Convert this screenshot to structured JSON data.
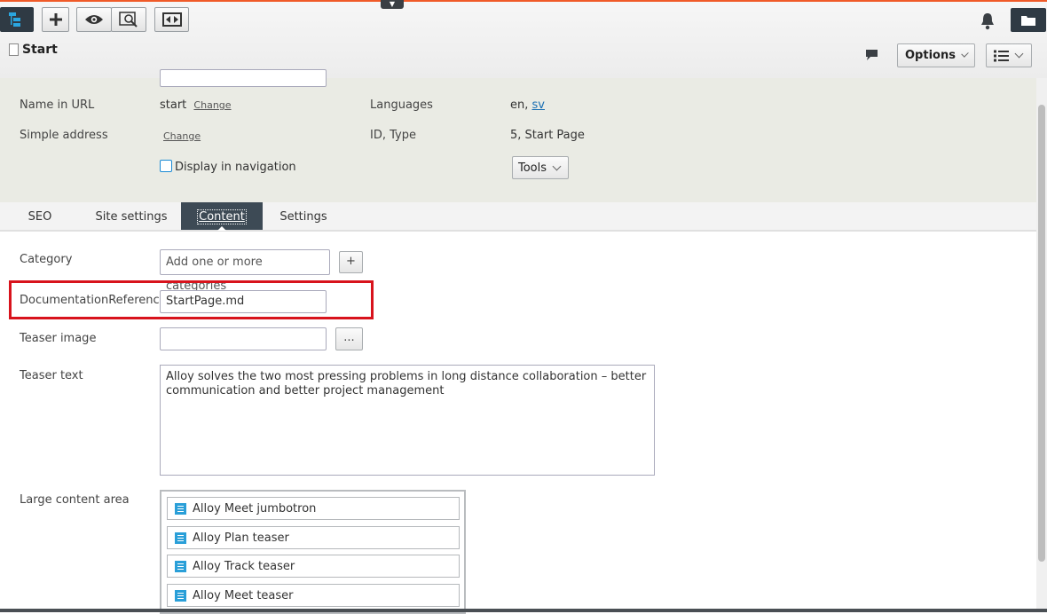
{
  "header": {
    "page_title": "Start",
    "options_label": "Options"
  },
  "props": {
    "name_url_label": "Name in URL",
    "name_url_value": "start",
    "change_link": "Change",
    "languages_label": "Languages",
    "languages_value": "en,",
    "languages_link": "sv",
    "simple_address_label": "Simple address",
    "simple_address_change": "Change",
    "id_type_label": "ID, Type",
    "id_type_value": "5, Start Page",
    "display_nav_label": "Display in navigation",
    "tools_label": "Tools"
  },
  "tabs": [
    {
      "label": "SEO"
    },
    {
      "label": "Site settings"
    },
    {
      "label": "Content"
    },
    {
      "label": "Settings"
    }
  ],
  "form": {
    "category_label": "Category",
    "category_placeholder": "Add one or more categories",
    "add_symbol": "+",
    "doc_ref_label": "DocumentationReference",
    "doc_ref_value": "StartPage.md",
    "teaser_image_label": "Teaser image",
    "browse_symbol": "...",
    "teaser_text_label": "Teaser text",
    "teaser_text_value": "Alloy solves the two most pressing problems in long distance collaboration – better communication and better project management",
    "large_content_label": "Large content area",
    "content_items": [
      {
        "label": "Alloy Meet jumbotron"
      },
      {
        "label": "Alloy Plan teaser"
      },
      {
        "label": "Alloy Track teaser"
      },
      {
        "label": "Alloy Meet teaser"
      }
    ]
  },
  "colors": {
    "accent": "#f05a28",
    "highlight": "#d8131c",
    "tab_active": "#3d4a55",
    "block_icon": "#2a9fd8"
  }
}
